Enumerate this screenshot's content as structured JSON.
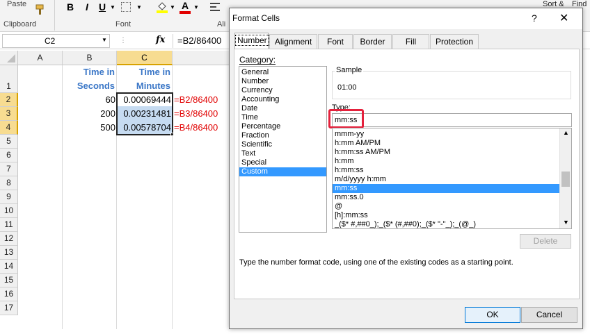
{
  "ribbon": {
    "paste_label": "Paste",
    "clipboard_group": "Clipboard",
    "font_group": "Font",
    "alignment_group_partial": "Ali",
    "bold_label": "B",
    "italic_label": "I",
    "underline_label": "U",
    "sort_label": "Sort &",
    "find_label": "Find"
  },
  "formula_bar": {
    "name_box": "C2",
    "fx_label": "fx",
    "formula": "=B2/86400"
  },
  "sheet": {
    "columns": [
      "A",
      "B",
      "C"
    ],
    "rows": [
      "1",
      "2",
      "3",
      "4",
      "5",
      "6",
      "7",
      "8",
      "9",
      "10",
      "11",
      "12",
      "13",
      "14",
      "15",
      "16",
      "17"
    ],
    "headers": {
      "b_line1": "Time in",
      "b_line2": "Seconds",
      "c_line1": "Time in",
      "c_line2": "Minutes"
    },
    "data": [
      {
        "b": "60",
        "c": "0.00069444",
        "formula": "=B2/86400"
      },
      {
        "b": "200",
        "c": "0.00231481",
        "formula": "=B3/86400"
      },
      {
        "b": "500",
        "c": "0.00578704",
        "formula": "=B4/86400"
      }
    ]
  },
  "dialog": {
    "title": "Format Cells",
    "help_label": "?",
    "close_label": "✕",
    "tabs": [
      "Number",
      "Alignment",
      "Font",
      "Border",
      "Fill",
      "Protection"
    ],
    "active_tab": "Number",
    "category_label": "Category:",
    "categories": [
      "General",
      "Number",
      "Currency",
      "Accounting",
      "Date",
      "Time",
      "Percentage",
      "Fraction",
      "Scientific",
      "Text",
      "Special",
      "Custom"
    ],
    "selected_category": "Custom",
    "sample_label": "Sample",
    "sample_value": "01:00",
    "type_label": "Type:",
    "type_value": "mm:ss",
    "type_list": [
      "mmm-yy",
      "h:mm AM/PM",
      "h:mm:ss AM/PM",
      "h:mm",
      "h:mm:ss",
      "m/d/yyyy h:mm",
      "mm:ss",
      "mm:ss.0",
      "@",
      "[h]:mm:ss",
      "_($* #,##0_);_($* (#,##0);_($* \"-\"_);_(@_)"
    ],
    "selected_type": "mm:ss",
    "delete_label": "Delete",
    "description": "Type the number format code, using one of the existing codes as a starting point.",
    "ok_label": "OK",
    "cancel_label": "Cancel"
  },
  "colors": {
    "accent_blue": "#3399ff",
    "header_text_blue": "#3b77c7",
    "formula_red": "#e10000",
    "highlight_red": "#e4213c",
    "selected_header": "#f7dc91"
  }
}
